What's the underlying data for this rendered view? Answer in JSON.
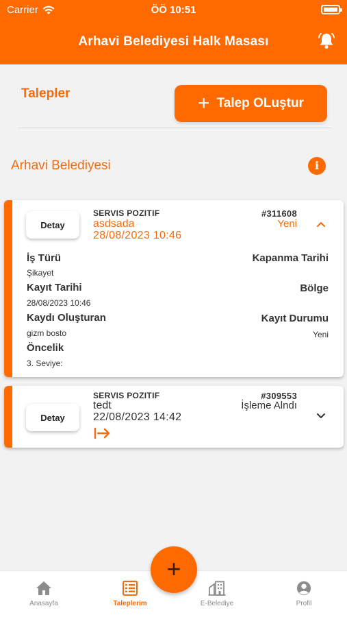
{
  "status_bar": {
    "carrier": "Carrier",
    "time": "ÖÖ 10:51"
  },
  "header": {
    "title": "Arhavi Belediyesi Halk Masası"
  },
  "requests": {
    "section_title": "Talepler",
    "create_button": {
      "plus": "+",
      "label": "Talep OLuştur"
    },
    "organization": "Arhavi Belediyesi",
    "info_glyph": "i"
  },
  "cards": [
    {
      "detail_button": "Detay",
      "service": "SERVIS POZITIF",
      "subject": "asdsada",
      "date": "28/08/2023 10:46",
      "number": "#311608",
      "status": "Yeni",
      "expanded": true,
      "fields": {
        "work_type_label": "İş Türü",
        "work_type_value": "Şikayet",
        "close_date_label": "Kapanma Tarihi",
        "record_date_label": "Kayıt Tarihi",
        "record_date_value": "28/08/2023 10:46",
        "region_label": "Bölge",
        "creator_label": "Kaydı Oluşturan",
        "creator_value": "gizm bosto",
        "record_status_label": "Kayıt Durumu",
        "record_status_value": "Yeni",
        "priority_label": "Öncelik",
        "priority_value": "3. Seviye:"
      }
    },
    {
      "detail_button": "Detay",
      "service": "SERVIS POZITIF",
      "subject": "tedt",
      "date": "22/08/2023 14:42",
      "number": "#309553",
      "status": "İşleme Alndı",
      "expanded": false
    }
  ],
  "fab": {
    "label": "+"
  },
  "tabs": [
    {
      "label": "Anasayfa",
      "icon": "home-icon",
      "active": false
    },
    {
      "label": "Taleplerim",
      "icon": "list-icon",
      "active": true
    },
    {
      "label": "E-Belediye",
      "icon": "building-icon",
      "active": false
    },
    {
      "label": "Profil",
      "icon": "profile-icon",
      "active": false
    }
  ],
  "colors": {
    "accent": "#ff6a00",
    "background": "#f2f2f2",
    "inactive_tab": "#8c8c8c"
  }
}
